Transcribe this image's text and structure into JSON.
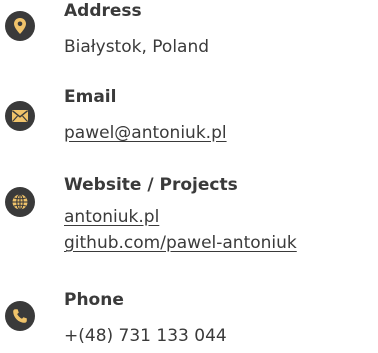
{
  "contacts": {
    "address": {
      "icon": "location-pin-icon",
      "label": "Address",
      "value": "Białystok, Poland"
    },
    "email": {
      "icon": "envelope-icon",
      "label": "Email",
      "link": "pawel@antoniuk.pl"
    },
    "website": {
      "icon": "globe-icon",
      "label": "Website / Projects",
      "links": [
        "antoniuk.pl",
        "github.com/pawel-antoniuk"
      ]
    },
    "phone": {
      "icon": "phone-icon",
      "label": "Phone",
      "value": "+(48) 731 133 044"
    }
  },
  "colors": {
    "icon_background": "#3a3a3a",
    "icon_glyph": "#f0c36a",
    "text": "#3a3a3a",
    "background": "#ffffff"
  }
}
